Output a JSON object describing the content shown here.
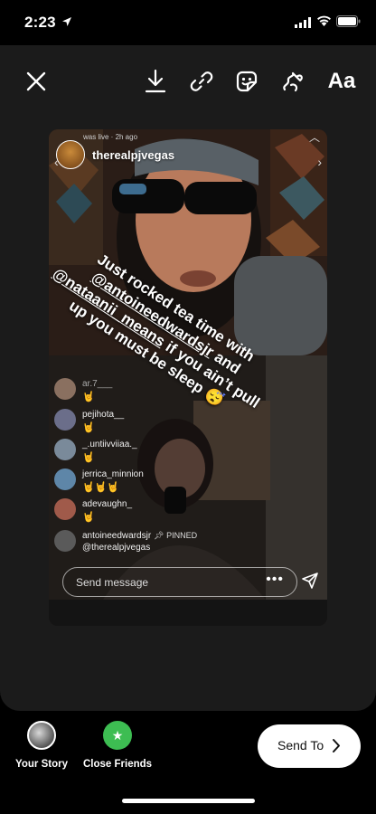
{
  "status_bar": {
    "time": "2:23"
  },
  "toolbar": {
    "text_tool_label": "Aa"
  },
  "story": {
    "was_live_text": "was live · 2h ago",
    "username": "therealpjvegas",
    "caption_line1": "Just rocked tea time with",
    "caption_mention1": "@antoineedwardsjr",
    "caption_line2": " and",
    "caption_mention2": "@nataanii_means",
    "caption_line3": " if you ain’t pull up you must be sleep",
    "caption_emoji": "😴",
    "comments": [
      {
        "name": "ar.7___",
        "text": "🤘",
        "avatar_color": "#8a7060"
      },
      {
        "name": "pejihota__",
        "text": "🤘",
        "avatar_color": "#6b6e8a"
      },
      {
        "name": "_.untiivviiaa._",
        "text": "🤘",
        "avatar_color": "#7a8a9a"
      },
      {
        "name": "jerrica_minnion",
        "text": "🤘🤘🤘",
        "avatar_color": "#5e86a8"
      },
      {
        "name": "adevaughn_",
        "text": "🤘",
        "avatar_color": "#a05a4a"
      },
      {
        "name": "antoineedwardsjr",
        "pinned_label": "PINNED",
        "subtext": "@therealpjvegas",
        "avatar_color": "#5a5a5a"
      }
    ],
    "message_placeholder": "Send message",
    "more_dots": "•••"
  },
  "share_bar": {
    "your_story_label": "Your Story",
    "close_friends_label": "Close Friends",
    "send_to_label": "Send To"
  },
  "colors": {
    "close_friends_green": "#3dbd52",
    "sheet_bg": "#1b1b1b"
  }
}
